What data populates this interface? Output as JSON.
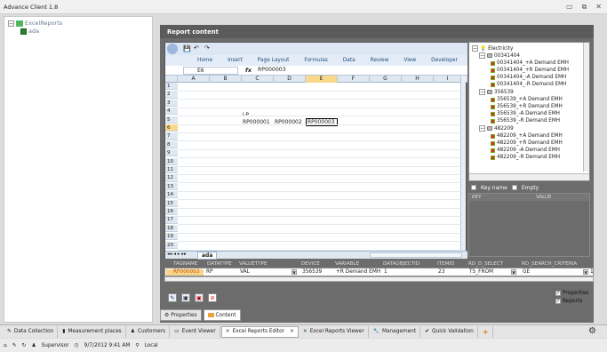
{
  "window": {
    "title": "Advance Client 1.8",
    "minimize_icon": "minimize-icon",
    "restore_icon": "restore-icon",
    "close_icon": "close-icon"
  },
  "left_tree": {
    "root": "ExcelReports",
    "child": "ada"
  },
  "report": {
    "header": "Report content"
  },
  "excel": {
    "tabs": [
      "Home",
      "Insert",
      "Page Layout",
      "Formulas",
      "Data",
      "Review",
      "View",
      "Developer"
    ],
    "cell_ref": "E6",
    "fx": "fx",
    "formula_value": "RP000003",
    "columns": [
      "A",
      "B",
      "C",
      "D",
      "E",
      "F",
      "G",
      "H",
      "I"
    ],
    "rows": [
      "1",
      "2",
      "3",
      "4",
      "5",
      "6",
      "7",
      "8",
      "9",
      "10",
      "11",
      "12",
      "13",
      "14",
      "15",
      "16",
      "17",
      "18",
      "19",
      "20"
    ],
    "c5": "LP",
    "c6": "RP000001",
    "d6": "RP000002",
    "e6": "RP000003",
    "sheet_tab": "ada"
  },
  "electricity_tree": {
    "root": "Electricity",
    "groups": [
      {
        "name": "00341404",
        "items": [
          "00341404_+A Demand EMH",
          "00341404_+R Demand EMH",
          "00341404_-A Demand EMH",
          "00341404_-R Demand EMH"
        ]
      },
      {
        "name": "356539",
        "items": [
          "356539_+A Demand EMH",
          "356539_+R Demand EMH",
          "356539_-A Demand EMH",
          "356539_-R Demand EMH"
        ]
      },
      {
        "name": "482209",
        "items": [
          "482209_+A Demand EMH",
          "482209_+R Demand EMH",
          "482209_-A Demand EMH",
          "482209_-R Demand EMH"
        ]
      }
    ]
  },
  "kv": {
    "keyname_label": "Key name",
    "empty_label": "Empty",
    "col_key": "KEY",
    "col_value": "VALUE"
  },
  "grid": {
    "headers": [
      "TAGNAME",
      "DATATYPE",
      "VALUETYPE",
      "DEVICE",
      "VARIABLE",
      "DATAOBJECTID",
      "ITEMID",
      "RD_D_SELECT",
      "RD_SEARCH_CRITERIA"
    ],
    "row": [
      "RP000003",
      "RP",
      "VAL",
      "356539",
      "+R Demand EMH",
      "1",
      "23",
      "TS_FROM",
      "GE"
    ],
    "trailing": "1"
  },
  "side_checks": {
    "properties": "Properties",
    "reports": "Reports"
  },
  "bottom_tabs": [
    "Properties",
    "Content"
  ],
  "taskbar": [
    "Data Collection",
    "Measurement places",
    "Customers",
    "Event Viewer",
    "Excel Reports Editor",
    "Excel Reports Viewer",
    "Management",
    "Quick Validation"
  ],
  "close_tab_glyph": "×",
  "status": {
    "user": "Supervisor",
    "datetime": "9/7/2012 9:41 AM",
    "mode": "Local"
  }
}
